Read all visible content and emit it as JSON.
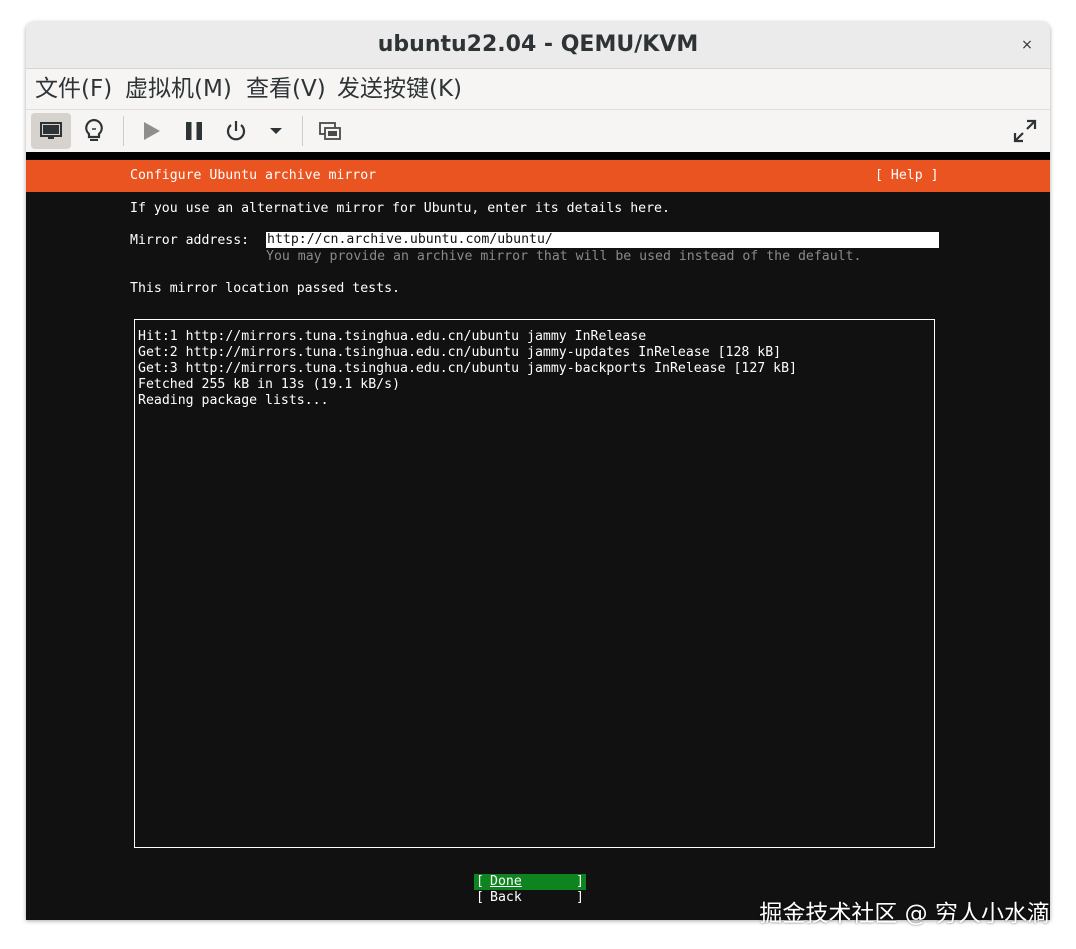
{
  "window": {
    "title": "ubuntu22.04 - QEMU/KVM",
    "close_glyph": "×"
  },
  "menu": {
    "items": [
      "文件(F)",
      "虚拟机(M)",
      "查看(V)",
      "发送按键(K)"
    ]
  },
  "toolbar": {
    "buttons": [
      "console-icon",
      "lightbulb-icon",
      "play-icon",
      "pause-icon",
      "power-icon",
      "dropdown-icon",
      "snapshot-icon",
      "fullscreen-icon"
    ]
  },
  "installer": {
    "header_title": "Configure Ubuntu archive mirror",
    "help_label": "[ Help ]",
    "intro": "If you use an alternative mirror for Ubuntu, enter its details here.",
    "mirror_label": "Mirror address:",
    "mirror_value": "http://cn.archive.ubuntu.com/ubuntu/",
    "mirror_hint": "You may provide an archive mirror that will be used instead of the default.",
    "status": "This mirror location passed tests.",
    "log_lines": [
      "Hit:1 http://mirrors.tuna.tsinghua.edu.cn/ubuntu jammy InRelease",
      "Get:2 http://mirrors.tuna.tsinghua.edu.cn/ubuntu jammy-updates InRelease [128 kB]",
      "Get:3 http://mirrors.tuna.tsinghua.edu.cn/ubuntu jammy-backports InRelease [127 kB]",
      "Fetched 255 kB in 13s (19.1 kB/s)",
      "Reading package lists..."
    ],
    "done_label": "Done",
    "back_label": "Back",
    "bracket_left": "[",
    "bracket_right": "]"
  },
  "colors": {
    "ubuntu_orange": "#e95420",
    "done_green": "#0e8420",
    "terminal_bg": "#111111"
  },
  "watermark": "掘金技术社区 @ 穷人小水滴"
}
